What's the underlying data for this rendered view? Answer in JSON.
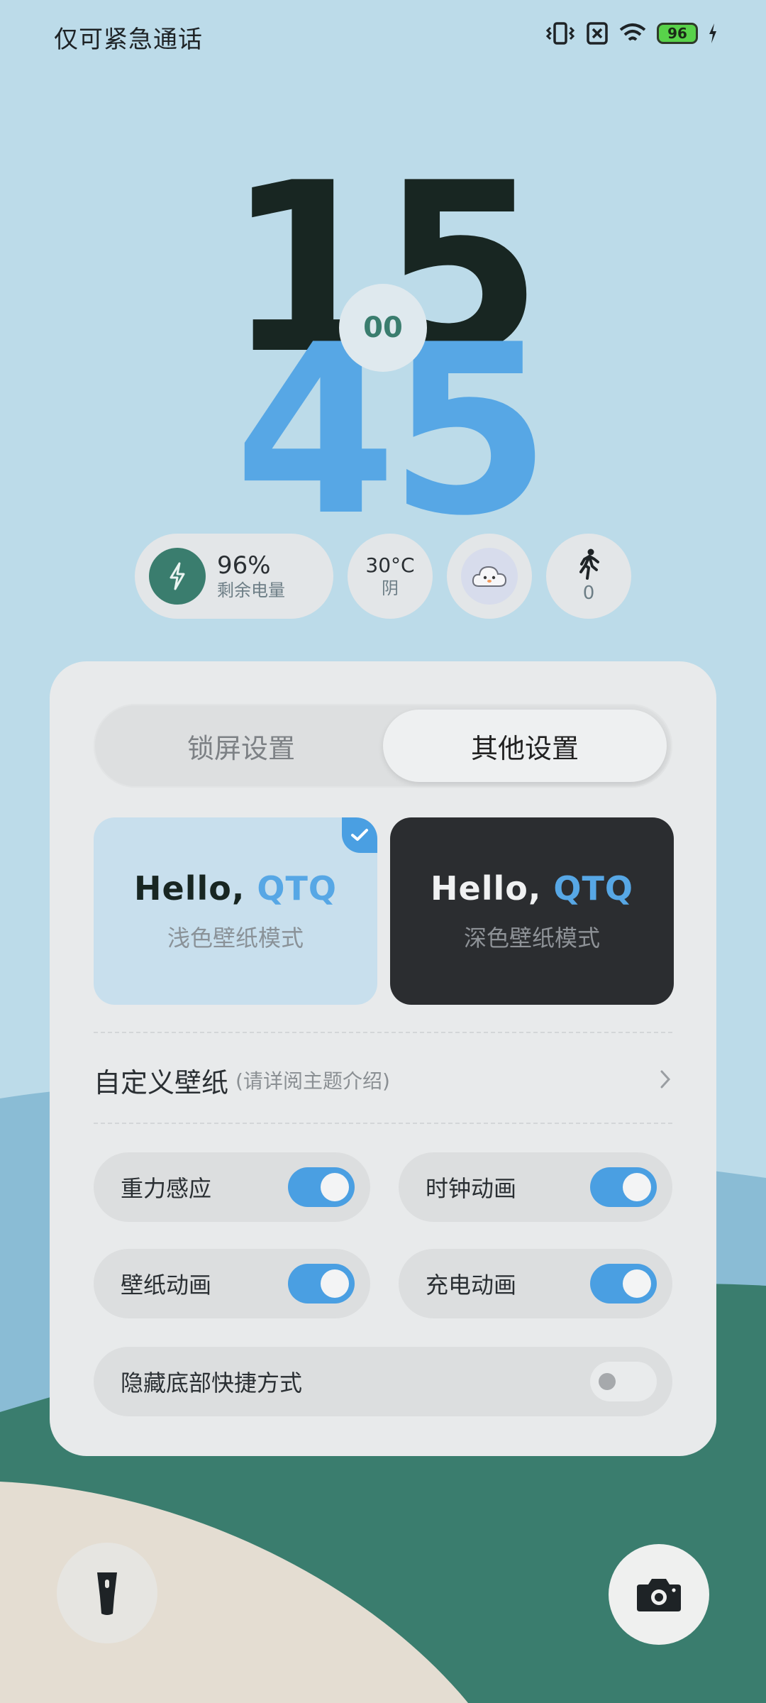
{
  "status_bar": {
    "carrier": "仅可紧急通话",
    "battery_level": "96",
    "icons": [
      "vibrate-icon",
      "no-sim-icon",
      "wifi-icon",
      "battery-icon",
      "charging-bolt-icon"
    ]
  },
  "clock": {
    "hour": "15",
    "minute": "45",
    "seconds": "00"
  },
  "widgets": {
    "battery": {
      "value": "96%",
      "label": "剩余电量",
      "icon": "charging-bolt-icon"
    },
    "weather": {
      "temp": "30°C",
      "condition": "阴"
    },
    "mascot": {
      "icon": "cloud-mascot-icon"
    },
    "steps": {
      "value": "0",
      "icon": "walking-icon"
    }
  },
  "settings": {
    "tabs": [
      {
        "label": "锁屏设置",
        "active": false
      },
      {
        "label": "其他设置",
        "active": true
      }
    ],
    "wallpaper_modes": [
      {
        "hello": "Hello,",
        "name": "QTQ",
        "label": "浅色壁纸模式",
        "selected": true
      },
      {
        "hello": "Hello,",
        "name": "QTQ",
        "label": "深色壁纸模式",
        "selected": false
      }
    ],
    "custom_wallpaper": {
      "title": "自定义壁纸",
      "hint": "(请详阅主题介绍)"
    },
    "toggles": [
      {
        "label": "重力感应",
        "on": true
      },
      {
        "label": "时钟动画",
        "on": true
      },
      {
        "label": "壁纸动画",
        "on": true
      },
      {
        "label": "充电动画",
        "on": true
      },
      {
        "label": "隐藏底部快捷方式",
        "on": false
      }
    ]
  },
  "shortcuts": {
    "left": "flashlight-icon",
    "right": "camera-icon"
  },
  "colors": {
    "sky": "#bcdbe9",
    "accent_blue": "#57a7e5",
    "switch_on": "#4a9fe2",
    "teal": "#3a7d6e",
    "dark_green": "#182622"
  }
}
